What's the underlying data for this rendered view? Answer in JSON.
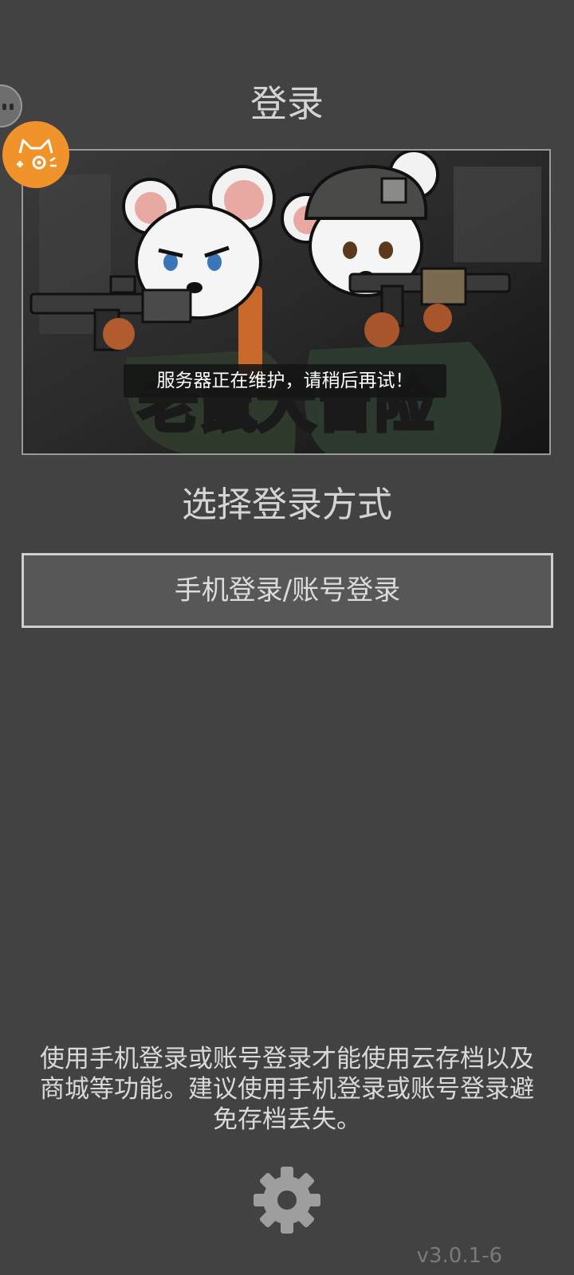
{
  "header": {
    "title": "登录"
  },
  "banner": {
    "image_description": "two armed mice characters",
    "game_title": "老鼠大冒险"
  },
  "toast": {
    "message": "服务器正在维护，请稍后再试！"
  },
  "login": {
    "prompt": "选择登录方式",
    "phone_account_button": "手机登录/账号登录"
  },
  "notice": {
    "text": "使用手机登录或账号登录才能使用云存档以及商城等功能。建议使用手机登录或账号登录避免存档丢失。"
  },
  "footer": {
    "settings_icon": "gear-icon",
    "version": "v3.0.1-6"
  },
  "floating": {
    "gray_icon": "assistant-face-icon",
    "orange_icon": "cat-face-icon"
  },
  "colors": {
    "background": "#424242",
    "accent_orange": "#f0932a",
    "button_bg": "#575757"
  }
}
